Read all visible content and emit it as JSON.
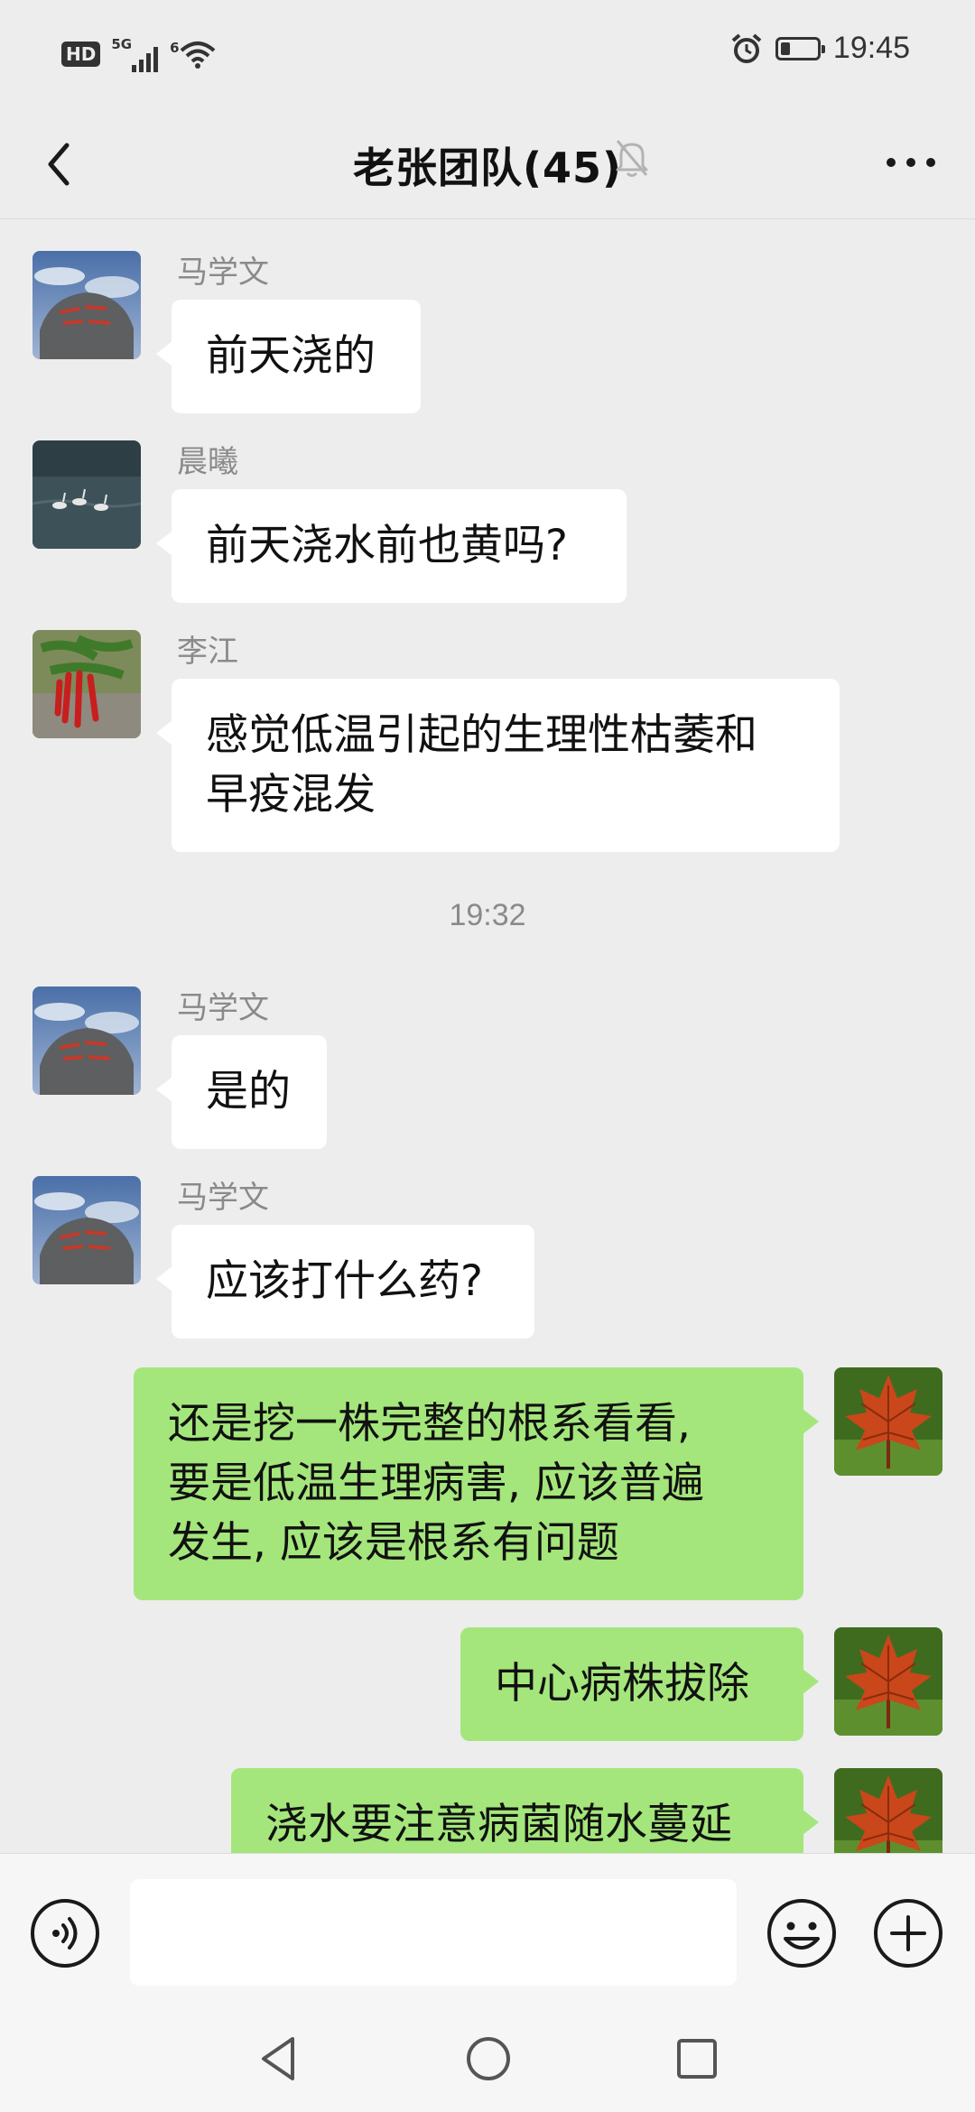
{
  "status_bar": {
    "hd_badge": "HD",
    "signal_label": "5G",
    "wifi_label": "6",
    "time": "19:45",
    "battery_level": 0.25
  },
  "nav": {
    "title": "老张团队(45)",
    "back_icon": "chevron-left-icon",
    "mute_icon": "bell-off-icon",
    "more_icon": "more-dots-icon"
  },
  "messages": [
    {
      "sender": "马学文",
      "text": "前天浇的"
    },
    {
      "sender": "晨曦",
      "text": "前天浇水前也黄吗?"
    },
    {
      "sender": "李江",
      "text": "感觉低温引起的生理性枯萎和\n早疫混发"
    },
    {
      "timestamp": "19:32"
    },
    {
      "sender": "马学文",
      "text": "是的"
    },
    {
      "sender": "马学文",
      "text": "应该打什么药?"
    },
    {
      "self": true,
      "text": "还是挖一株完整的根系看看,\n要是低温生理病害, 应该普遍\n发生, 应该是根系有问题"
    },
    {
      "self": true,
      "text": "中心病株拔除"
    },
    {
      "self": true,
      "text": "浇水要注意病菌随水蔓延"
    }
  ],
  "input": {
    "value": "",
    "placeholder": ""
  },
  "icons": {
    "voice": "voice-icon",
    "emoji": "emoji-icon",
    "plus": "plus-icon"
  },
  "colors": {
    "background": "#ededed",
    "bubble_self": "#a4e67b",
    "bubble_other": "#ffffff",
    "meta_text": "#8a8a8a"
  }
}
